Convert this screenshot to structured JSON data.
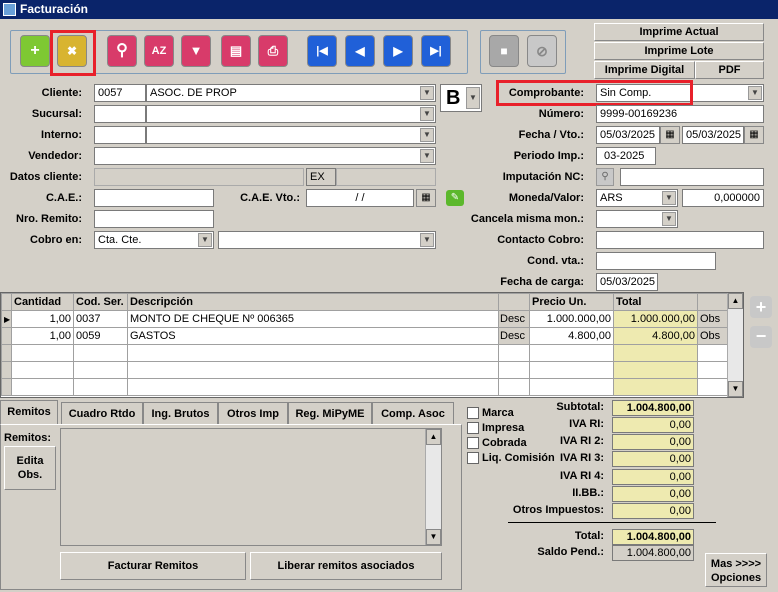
{
  "window": {
    "title": "Facturación"
  },
  "print_buttons": {
    "imprime_actual": "Imprime Actual",
    "imprime_lote": "Imprime Lote",
    "imprime_digital": "Imprime Digital",
    "pdf": "PDF"
  },
  "left": {
    "cliente": {
      "label": "Cliente:",
      "code": "0057",
      "name": "ASOC. DE PROP"
    },
    "letra": "B",
    "sucursal": {
      "label": "Sucursal:"
    },
    "interno": {
      "label": "Interno:"
    },
    "vendedor": {
      "label": "Vendedor:"
    },
    "datos_cliente": {
      "label": "Datos cliente:",
      "value": "EX"
    },
    "cae": {
      "label": "C.A.E.:"
    },
    "cae_vto": {
      "label": "C.A.E. Vto.:",
      "value": "  /  /"
    },
    "nro_remito": {
      "label": "Nro. Remito:"
    },
    "cobro_en": {
      "label": "Cobro en:",
      "value": "Cta. Cte."
    }
  },
  "right": {
    "comprobante": {
      "label": "Comprobante:",
      "value": "Sin Comp."
    },
    "numero": {
      "label": "Número:",
      "value": "9999-00169236"
    },
    "fecha_vto": {
      "label": "Fecha / Vto.:",
      "fecha": "05/03/2025",
      "vto": "05/03/2025"
    },
    "periodo_imp": {
      "label": "Periodo Imp.:",
      "value": "03-2025"
    },
    "imputacion_nc": {
      "label": "Imputación NC:"
    },
    "moneda_valor": {
      "label": "Moneda/Valor:",
      "moneda": "ARS",
      "valor": "0,000000"
    },
    "cancela": {
      "label": "Cancela misma mon.:"
    },
    "contacto_cobro": {
      "label": "Contacto Cobro:"
    },
    "cond_vta": {
      "label": "Cond. vta.:"
    },
    "fecha_carga": {
      "label": "Fecha de carga:",
      "value": "05/03/2025"
    }
  },
  "grid": {
    "headers": [
      "Cantidad",
      "Cod. Ser.",
      "Descripción",
      "",
      "Precio Un.",
      "Total",
      ""
    ],
    "rows": [
      {
        "cantidad": "1,00",
        "cod": "0037",
        "desc": "MONTO DE CHEQUE Nº 006365",
        "btn": "Desc",
        "precio": "1.000.000,00",
        "total": "1.000.000,00",
        "obs": "Obs"
      },
      {
        "cantidad": "1,00",
        "cod": "0059",
        "desc": "GASTOS",
        "btn": "Desc",
        "precio": "4.800,00",
        "total": "4.800,00",
        "obs": "Obs"
      }
    ]
  },
  "tabs": [
    "Remitos",
    "Cuadro Rtdo",
    "Ing. Brutos",
    "Otros Imp",
    "Reg. MiPyME",
    "Comp. Asoc"
  ],
  "remitos": {
    "label": "Remitos:",
    "edita_obs_1": "Edita",
    "edita_obs_2": "Obs.",
    "facturar": "Facturar Remitos",
    "liberar": "Liberar remitos asociados"
  },
  "checks": [
    "Marca",
    "Impresa",
    "Cobrada",
    "Liq. Comisión"
  ],
  "totals": {
    "subtotal": {
      "label": "Subtotal:",
      "value": "1.004.800,00"
    },
    "iva1": {
      "label": "IVA RI:",
      "value": "0,00"
    },
    "iva2": {
      "label": "IVA RI 2:",
      "value": "0,00"
    },
    "iva3": {
      "label": "IVA RI 3:",
      "value": "0,00"
    },
    "iva4": {
      "label": "IVA RI 4:",
      "value": "0,00"
    },
    "iibb": {
      "label": "II.BB.:",
      "value": "0,00"
    },
    "otros": {
      "label": "Otros Impuestos:",
      "value": "0,00"
    },
    "total": {
      "label": "Total:",
      "value": "1.004.800,00"
    },
    "saldo": {
      "label": "Saldo Pend.:",
      "value": "1.004.800,00"
    }
  },
  "mas_opciones_1": "Mas >>>>",
  "mas_opciones_2": "Opciones"
}
